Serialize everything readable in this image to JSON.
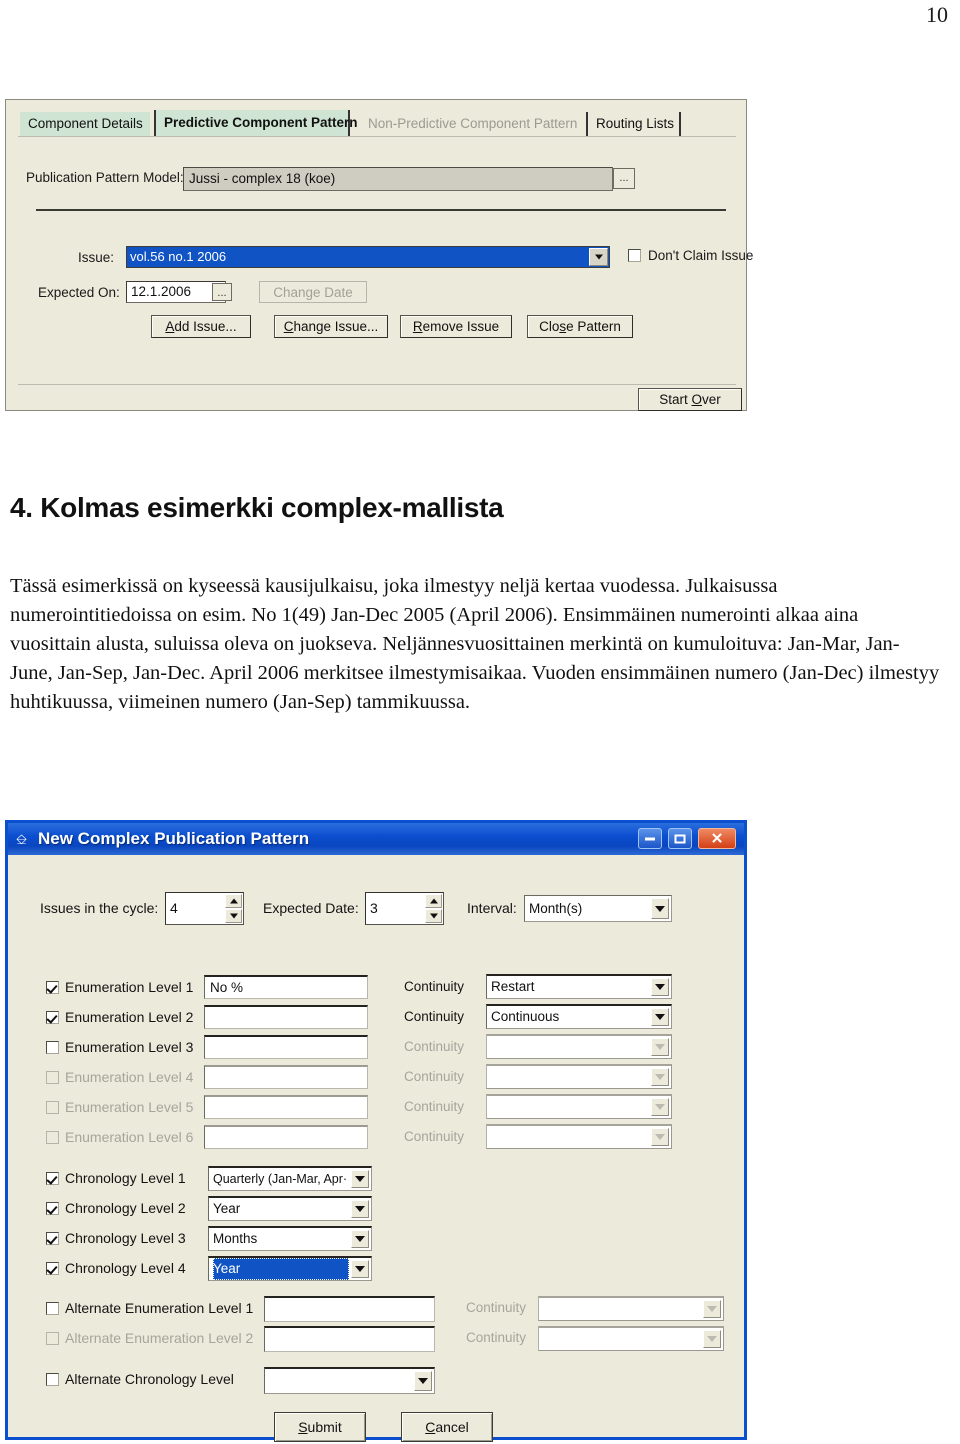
{
  "page": {
    "number": "10"
  },
  "dialog1": {
    "tabs": [
      {
        "label": "Component Details",
        "state": "normal"
      },
      {
        "label": "Predictive Component Pattern",
        "state": "selected"
      },
      {
        "label": "Non-Predictive Component Pattern",
        "state": "disabled"
      },
      {
        "label": "Routing Lists",
        "state": "normal"
      }
    ],
    "model_label": "Publication Pattern Model:",
    "model_value": "Jussi - complex 18 (koe)",
    "browse_label": "...",
    "issue_label": "Issue:",
    "issue_value": "vol.56 no.1 2006",
    "dont_claim_label": "Don't Claim Issue",
    "expected_on_label": "Expected On:",
    "expected_on_value": "12.1.2006",
    "expected_browse_label": "...",
    "change_date_label": "Change Date",
    "buttons": {
      "add_issue": "Add Issue...",
      "change_issue": "Change Issue...",
      "remove_issue": "Remove Issue",
      "close_pattern": "Close Pattern",
      "start_over": "Start Over"
    }
  },
  "article": {
    "heading": "4. Kolmas esimerkki complex-mallista",
    "body": "Tässä esimerkissä on kyseessä kausijulkaisu, joka ilmestyy neljä kertaa vuodessa. Julkaisussa numerointitiedoissa on esim. No 1(49) Jan-Dec 2005 (April 2006). Ensimmäinen numerointi alkaa aina vuosittain alusta, suluissa oleva on juokseva. Neljännesvuosittainen merkintä on kumuloituva: Jan-Mar, Jan-June, Jan-Sep, Jan-Dec. April 2006 merkitsee ilmestymisaikaa. Vuoden ensimmäinen numero (Jan-Dec) ilmestyy huhtikuussa, viimeinen numero (Jan-Sep) tammikuussa."
  },
  "dialog2": {
    "title": "New Complex Publication Pattern",
    "titlebar_icon": "document-icon",
    "window_buttons": {
      "minimize": "minimize-icon",
      "maximize": "maximize-icon",
      "close": "close-icon"
    },
    "top_row": {
      "issues_label": "Issues in the cycle:",
      "issues_value": "4",
      "expected_date_label": "Expected Date:",
      "expected_date_value": "3",
      "interval_label": "Interval:",
      "interval_value": "Month(s)"
    },
    "continuity_label": "Continuity",
    "enumeration_levels": [
      {
        "label": "Enumeration Level 1",
        "checked": true,
        "enabled": true,
        "value": "No %",
        "continuity": "Restart",
        "continuity_enabled": true
      },
      {
        "label": "Enumeration Level 2",
        "checked": true,
        "enabled": true,
        "value": "",
        "continuity": "Continuous",
        "continuity_enabled": true
      },
      {
        "label": "Enumeration Level 3",
        "checked": false,
        "enabled": true,
        "value": "",
        "continuity": "",
        "continuity_enabled": false
      },
      {
        "label": "Enumeration Level 4",
        "checked": false,
        "enabled": false,
        "value": "",
        "continuity": "",
        "continuity_enabled": false
      },
      {
        "label": "Enumeration Level 5",
        "checked": false,
        "enabled": false,
        "value": "",
        "continuity": "",
        "continuity_enabled": false
      },
      {
        "label": "Enumeration Level 6",
        "checked": false,
        "enabled": false,
        "value": "",
        "continuity": "",
        "continuity_enabled": false
      }
    ],
    "chronology_levels": [
      {
        "label": "Chronology Level 1",
        "checked": true,
        "value": "Quarterly (Jan-Mar, Apr·",
        "selected": false
      },
      {
        "label": "Chronology Level 2",
        "checked": true,
        "value": "Year",
        "selected": false
      },
      {
        "label": "Chronology Level 3",
        "checked": true,
        "value": "Months",
        "selected": false
      },
      {
        "label": "Chronology Level 4",
        "checked": true,
        "value": "Year",
        "selected": true
      }
    ],
    "alternate_enumeration": [
      {
        "label": "Alternate Enumeration Level 1",
        "checked": false,
        "enabled": true,
        "value": "",
        "continuity": "",
        "continuity_enabled": false
      },
      {
        "label": "Alternate Enumeration Level 2",
        "checked": false,
        "enabled": false,
        "value": "",
        "continuity": "",
        "continuity_enabled": false
      }
    ],
    "alternate_chronology": {
      "label": "Alternate Chronology Level",
      "checked": false,
      "value": ""
    },
    "buttons": {
      "submit": "Submit",
      "cancel": "Cancel"
    }
  }
}
